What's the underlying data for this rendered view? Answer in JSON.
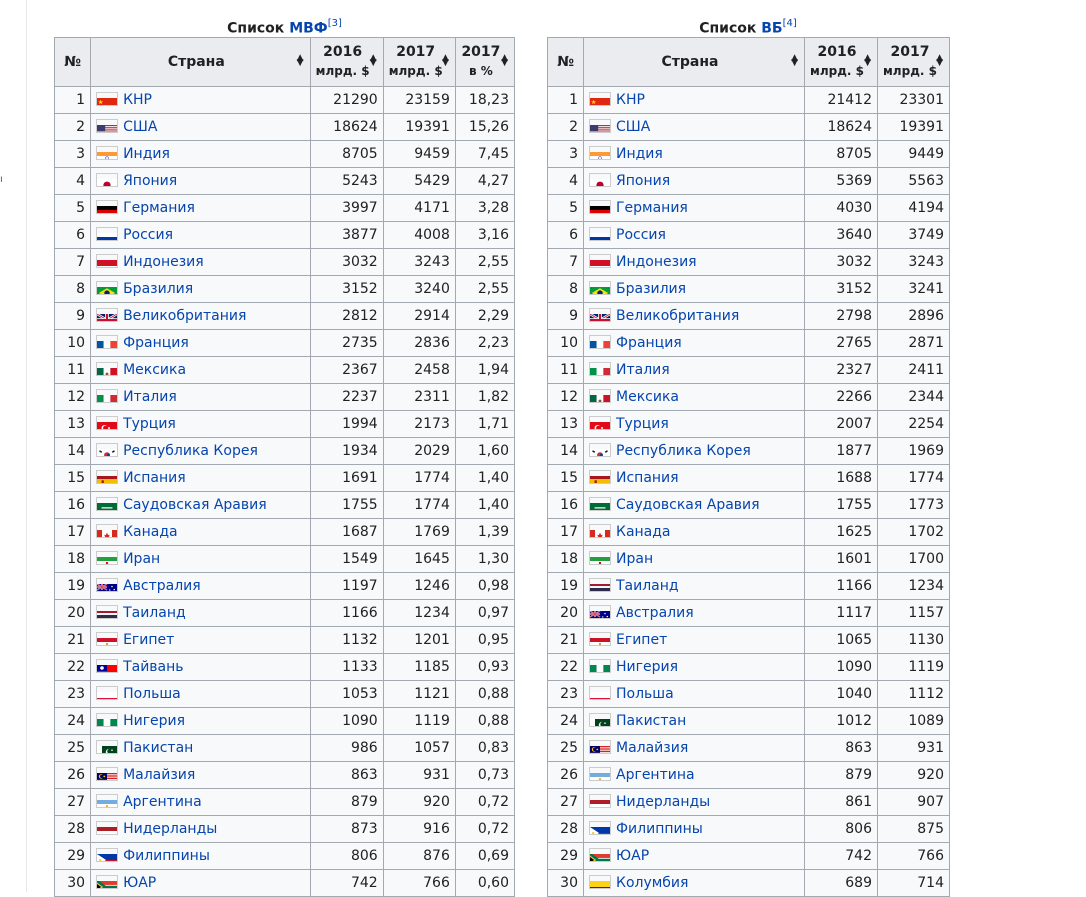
{
  "imf": {
    "caption_prefix": "Список ",
    "caption_link": "МВФ",
    "caption_ref": "[3]",
    "headers": {
      "rank": "№",
      "country": "Страна",
      "y2016": "2016",
      "y2016_unit": "млрд. $",
      "y2017": "2017",
      "y2017_unit": "млрд. $",
      "y2017pct": "2017",
      "y2017pct_unit": "в %"
    },
    "rows": [
      {
        "rank": "1",
        "country": "КНР",
        "flag": "cn",
        "v2016": "21290",
        "v2017": "23159",
        "pct": "18,23"
      },
      {
        "rank": "2",
        "country": "США",
        "flag": "us",
        "v2016": "18624",
        "v2017": "19391",
        "pct": "15,26"
      },
      {
        "rank": "3",
        "country": "Индия",
        "flag": "in",
        "v2016": "8705",
        "v2017": "9459",
        "pct": "7,45"
      },
      {
        "rank": "4",
        "country": "Япония",
        "flag": "jp",
        "v2016": "5243",
        "v2017": "5429",
        "pct": "4,27"
      },
      {
        "rank": "5",
        "country": "Германия",
        "flag": "de",
        "v2016": "3997",
        "v2017": "4171",
        "pct": "3,28"
      },
      {
        "rank": "6",
        "country": "Россия",
        "flag": "ru",
        "v2016": "3877",
        "v2017": "4008",
        "pct": "3,16"
      },
      {
        "rank": "7",
        "country": "Индонезия",
        "flag": "id",
        "v2016": "3032",
        "v2017": "3243",
        "pct": "2,55"
      },
      {
        "rank": "8",
        "country": "Бразилия",
        "flag": "br",
        "v2016": "3152",
        "v2017": "3240",
        "pct": "2,55"
      },
      {
        "rank": "9",
        "country": "Великобритания",
        "flag": "gb",
        "v2016": "2812",
        "v2017": "2914",
        "pct": "2,29"
      },
      {
        "rank": "10",
        "country": "Франция",
        "flag": "fr",
        "v2016": "2735",
        "v2017": "2836",
        "pct": "2,23"
      },
      {
        "rank": "11",
        "country": "Мексика",
        "flag": "mx",
        "v2016": "2367",
        "v2017": "2458",
        "pct": "1,94"
      },
      {
        "rank": "12",
        "country": "Италия",
        "flag": "it",
        "v2016": "2237",
        "v2017": "2311",
        "pct": "1,82"
      },
      {
        "rank": "13",
        "country": "Турция",
        "flag": "tr",
        "v2016": "1994",
        "v2017": "2173",
        "pct": "1,71"
      },
      {
        "rank": "14",
        "country": "Республика Корея",
        "flag": "kr",
        "v2016": "1934",
        "v2017": "2029",
        "pct": "1,60"
      },
      {
        "rank": "15",
        "country": "Испания",
        "flag": "es",
        "v2016": "1691",
        "v2017": "1774",
        "pct": "1,40"
      },
      {
        "rank": "16",
        "country": "Саудовская Аравия",
        "flag": "sa",
        "v2016": "1755",
        "v2017": "1774",
        "pct": "1,40"
      },
      {
        "rank": "17",
        "country": "Канада",
        "flag": "ca",
        "v2016": "1687",
        "v2017": "1769",
        "pct": "1,39"
      },
      {
        "rank": "18",
        "country": "Иран",
        "flag": "ir",
        "v2016": "1549",
        "v2017": "1645",
        "pct": "1,30"
      },
      {
        "rank": "19",
        "country": "Австралия",
        "flag": "au",
        "v2016": "1197",
        "v2017": "1246",
        "pct": "0,98"
      },
      {
        "rank": "20",
        "country": "Таиланд",
        "flag": "th",
        "v2016": "1166",
        "v2017": "1234",
        "pct": "0,97"
      },
      {
        "rank": "21",
        "country": "Египет",
        "flag": "eg",
        "v2016": "1132",
        "v2017": "1201",
        "pct": "0,95"
      },
      {
        "rank": "22",
        "country": "Тайвань",
        "flag": "tw",
        "v2016": "1133",
        "v2017": "1185",
        "pct": "0,93"
      },
      {
        "rank": "23",
        "country": "Польша",
        "flag": "pl",
        "v2016": "1053",
        "v2017": "1121",
        "pct": "0,88"
      },
      {
        "rank": "24",
        "country": "Нигерия",
        "flag": "ng",
        "v2016": "1090",
        "v2017": "1119",
        "pct": "0,88"
      },
      {
        "rank": "25",
        "country": "Пакистан",
        "flag": "pk",
        "v2016": "986",
        "v2017": "1057",
        "pct": "0,83"
      },
      {
        "rank": "26",
        "country": "Малайзия",
        "flag": "my",
        "v2016": "863",
        "v2017": "931",
        "pct": "0,73"
      },
      {
        "rank": "27",
        "country": "Аргентина",
        "flag": "ar",
        "v2016": "879",
        "v2017": "920",
        "pct": "0,72"
      },
      {
        "rank": "28",
        "country": "Нидерланды",
        "flag": "nl",
        "v2016": "873",
        "v2017": "916",
        "pct": "0,72"
      },
      {
        "rank": "29",
        "country": "Филиппины",
        "flag": "ph",
        "v2016": "806",
        "v2017": "876",
        "pct": "0,69"
      },
      {
        "rank": "30",
        "country": "ЮАР",
        "flag": "za",
        "v2016": "742",
        "v2017": "766",
        "pct": "0,60"
      }
    ]
  },
  "wb": {
    "caption_prefix": "Список ",
    "caption_link": "ВБ",
    "caption_ref": "[4]",
    "headers": {
      "rank": "№",
      "country": "Страна",
      "y2016": "2016",
      "y2016_unit": "млрд. $",
      "y2017": "2017",
      "y2017_unit": "млрд. $"
    },
    "rows": [
      {
        "rank": "1",
        "country": "КНР",
        "flag": "cn",
        "v2016": "21412",
        "v2017": "23301"
      },
      {
        "rank": "2",
        "country": "США",
        "flag": "us",
        "v2016": "18624",
        "v2017": "19391"
      },
      {
        "rank": "3",
        "country": "Индия",
        "flag": "in",
        "v2016": "8705",
        "v2017": "9449"
      },
      {
        "rank": "4",
        "country": "Япония",
        "flag": "jp",
        "v2016": "5369",
        "v2017": "5563"
      },
      {
        "rank": "5",
        "country": "Германия",
        "flag": "de",
        "v2016": "4030",
        "v2017": "4194"
      },
      {
        "rank": "6",
        "country": "Россия",
        "flag": "ru",
        "v2016": "3640",
        "v2017": "3749"
      },
      {
        "rank": "7",
        "country": "Индонезия",
        "flag": "id",
        "v2016": "3032",
        "v2017": "3243"
      },
      {
        "rank": "8",
        "country": "Бразилия",
        "flag": "br",
        "v2016": "3152",
        "v2017": "3241"
      },
      {
        "rank": "9",
        "country": "Великобритания",
        "flag": "gb",
        "v2016": "2798",
        "v2017": "2896"
      },
      {
        "rank": "10",
        "country": "Франция",
        "flag": "fr",
        "v2016": "2765",
        "v2017": "2871"
      },
      {
        "rank": "11",
        "country": "Италия",
        "flag": "it",
        "v2016": "2327",
        "v2017": "2411"
      },
      {
        "rank": "12",
        "country": "Мексика",
        "flag": "mx",
        "v2016": "2266",
        "v2017": "2344"
      },
      {
        "rank": "13",
        "country": "Турция",
        "flag": "tr",
        "v2016": "2007",
        "v2017": "2254"
      },
      {
        "rank": "14",
        "country": "Республика Корея",
        "flag": "kr",
        "v2016": "1877",
        "v2017": "1969"
      },
      {
        "rank": "15",
        "country": "Испания",
        "flag": "es",
        "v2016": "1688",
        "v2017": "1774"
      },
      {
        "rank": "16",
        "country": "Саудовская Аравия",
        "flag": "sa",
        "v2016": "1755",
        "v2017": "1773"
      },
      {
        "rank": "17",
        "country": "Канада",
        "flag": "ca",
        "v2016": "1625",
        "v2017": "1702"
      },
      {
        "rank": "18",
        "country": "Иран",
        "flag": "ir",
        "v2016": "1601",
        "v2017": "1700"
      },
      {
        "rank": "19",
        "country": "Таиланд",
        "flag": "th",
        "v2016": "1166",
        "v2017": "1234"
      },
      {
        "rank": "20",
        "country": "Австралия",
        "flag": "au",
        "v2016": "1117",
        "v2017": "1157"
      },
      {
        "rank": "21",
        "country": "Египет",
        "flag": "eg",
        "v2016": "1065",
        "v2017": "1130"
      },
      {
        "rank": "22",
        "country": "Нигерия",
        "flag": "ng",
        "v2016": "1090",
        "v2017": "1119"
      },
      {
        "rank": "23",
        "country": "Польша",
        "flag": "pl",
        "v2016": "1040",
        "v2017": "1112"
      },
      {
        "rank": "24",
        "country": "Пакистан",
        "flag": "pk",
        "v2016": "1012",
        "v2017": "1089"
      },
      {
        "rank": "25",
        "country": "Малайзия",
        "flag": "my",
        "v2016": "863",
        "v2017": "931"
      },
      {
        "rank": "26",
        "country": "Аргентина",
        "flag": "ar",
        "v2016": "879",
        "v2017": "920"
      },
      {
        "rank": "27",
        "country": "Нидерланды",
        "flag": "nl",
        "v2016": "861",
        "v2017": "907"
      },
      {
        "rank": "28",
        "country": "Филиппины",
        "flag": "ph",
        "v2016": "806",
        "v2017": "875"
      },
      {
        "rank": "29",
        "country": "ЮАР",
        "flag": "za",
        "v2016": "742",
        "v2017": "766"
      },
      {
        "rank": "30",
        "country": "Колумбия",
        "flag": "co",
        "v2016": "689",
        "v2017": "714"
      }
    ]
  },
  "sort_icon": "sort-icon",
  "colors": {
    "link": "#0645ad",
    "header_bg": "#eaecf0",
    "cell_bg": "#f8f9fa",
    "border": "#a2a9b1"
  }
}
